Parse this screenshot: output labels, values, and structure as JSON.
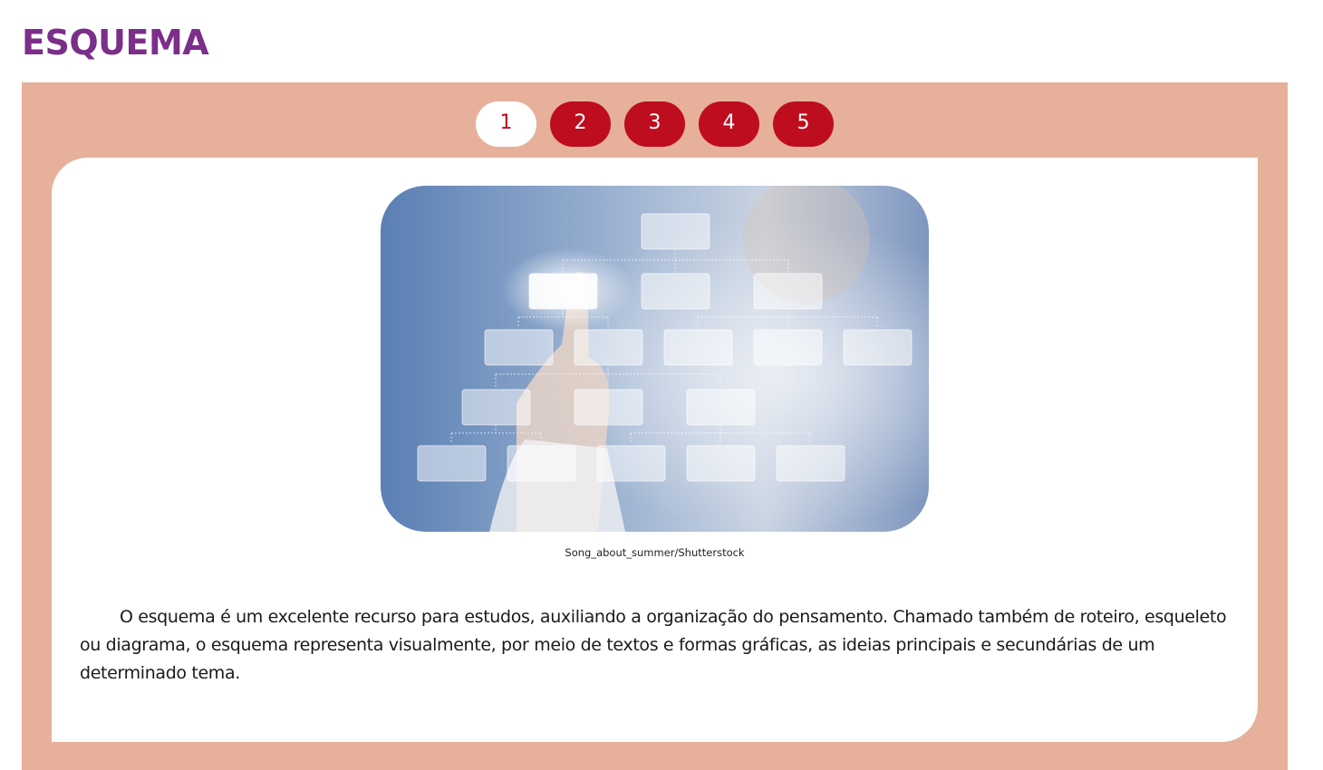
{
  "page": {
    "title": "ESQUEMA"
  },
  "colors": {
    "title": "#7b2e8a",
    "panel_background": "#e6b09a",
    "tab_inactive": "#be0d1f",
    "tab_active_bg": "#ffffff",
    "tab_active_text": "#be0d1f"
  },
  "tabs": [
    {
      "label": "1",
      "active": true
    },
    {
      "label": "2",
      "active": false
    },
    {
      "label": "3",
      "active": false
    },
    {
      "label": "4",
      "active": false
    },
    {
      "label": "5",
      "active": false
    }
  ],
  "content": {
    "image_credit": "Song_about_summer/Shutterstock",
    "paragraph": "O esquema é um excelente recurso para estudos, auxiliando a organização do pensamento. Chamado também de roteiro, esqueleto ou diagrama, o esquema representa visualmente, por meio de textos e formas gráficas, as ideias principais e secundárias de um determinado tema."
  }
}
